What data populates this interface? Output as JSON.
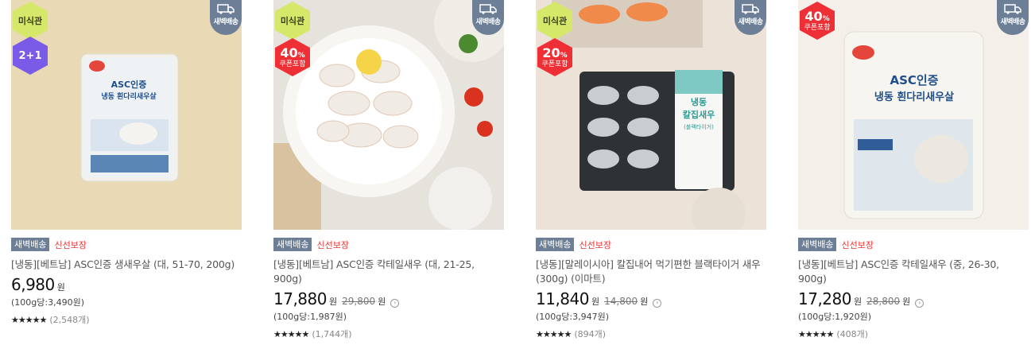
{
  "products": [
    {
      "badges": [
        "미식관",
        "2+1"
      ],
      "dawn_badge": "새벽배송",
      "tag_dawn": "새벽배송",
      "tag_fresh": "신선보장",
      "name": "[냉동][베트남] ASC인증 생새우살 (대, 51-70, 200g)",
      "price": "6,980",
      "won": "원",
      "unit_price": "(100g당:3,490원)",
      "stars": "★★★★★",
      "reviews": "(2,548개)",
      "image": "product-image-shrimp-pack"
    },
    {
      "badges": [
        "미식관"
      ],
      "coupon": {
        "pct": "40",
        "pct_sign": "%",
        "label": "쿠폰포함"
      },
      "dawn_badge": "새벽배송",
      "tag_dawn": "새벽배송",
      "tag_fresh": "신선보장",
      "name": "[냉동][베트남] ASC인증 칵테일새우 (대, 21-25, 900g)",
      "price": "17,880",
      "won": "원",
      "original_price": "29,800",
      "original_won": "원",
      "unit_price": "(100g당:1,987원)",
      "stars": "★★★★★",
      "reviews": "(1,744개)",
      "image": "product-image-shrimp-plate"
    },
    {
      "badges": [
        "미식관"
      ],
      "coupon": {
        "pct": "20",
        "pct_sign": "%",
        "label": "쿠폰포함"
      },
      "dawn_badge": "새벽배송",
      "tag_dawn": "새벽배송",
      "tag_fresh": "신선보장",
      "name": "[냉동][말레이시아] 칼집내어 먹기편한 블랙타이거 새우 (300g) (이마트)",
      "price": "11,840",
      "won": "원",
      "original_price": "14,800",
      "original_won": "원",
      "unit_price": "(100g당:3,947원)",
      "stars": "★★★★★",
      "reviews": "(894개)",
      "image": "product-image-tiger-shrimp-tray"
    },
    {
      "coupon": {
        "pct": "40",
        "pct_sign": "%",
        "label": "쿠폰포함"
      },
      "dawn_badge": "새벽배송",
      "tag_dawn": "새벽배송",
      "tag_fresh": "신선보장",
      "name": "[냉동][베트남] ASC인증 칵테일새우 (중, 26-30, 900g)",
      "price": "17,280",
      "won": "원",
      "original_price": "28,800",
      "original_won": "원",
      "unit_price": "(100g당:1,920원)",
      "stars": "★★★★★",
      "reviews": "(408개)",
      "image": "product-image-cocktail-shrimp-pack"
    }
  ],
  "pack_text": {
    "asc": "ASC인증",
    "line1": "냉동 흰다리새우살",
    "line2": "칼집새우",
    "line3": "(블랙타이거)",
    "prefix": "냉동"
  },
  "colors": {
    "dawn_bg": "#6d7f97",
    "fresh_text": "#ee3434",
    "coupon_bg": "#ee2f36",
    "mishikgwan_bg": "#d6e86a",
    "bundle_bg": "#7a5be8"
  }
}
